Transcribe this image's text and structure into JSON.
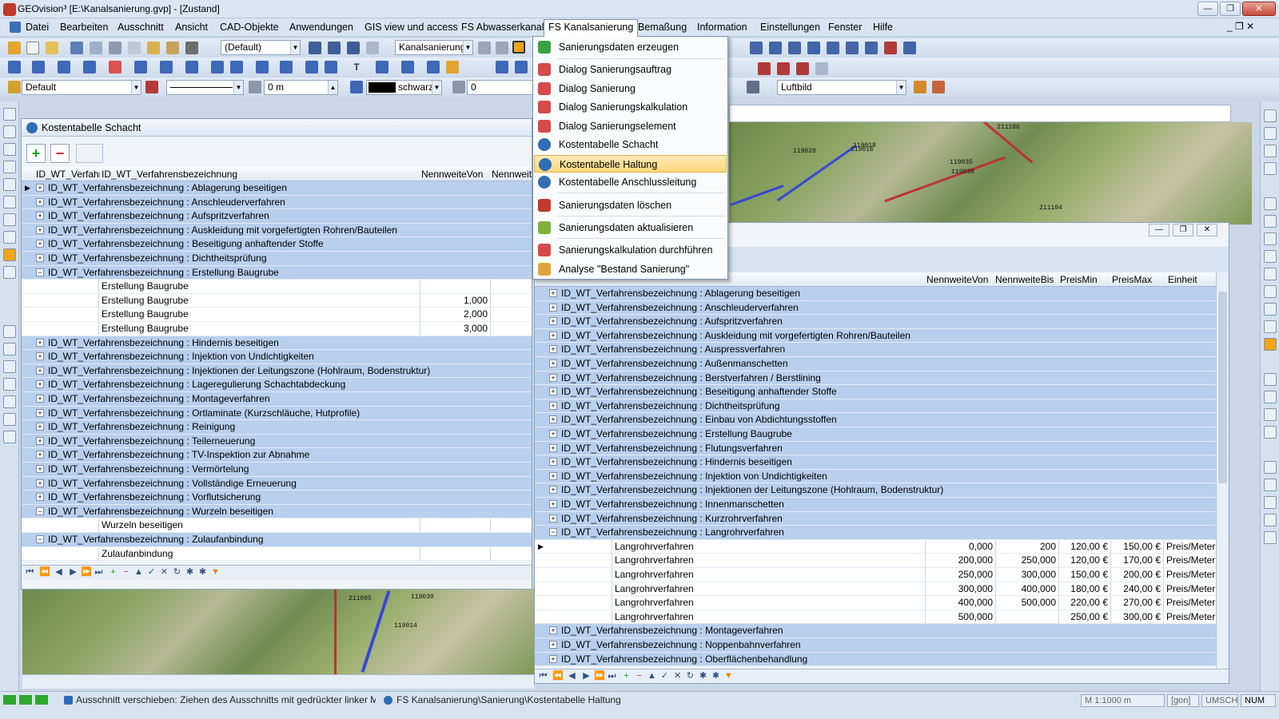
{
  "window": {
    "title": "GEOvision³  [E:\\Kanalsanierung.gvp] - [Zustand]",
    "minimize": "—",
    "restore": "❐",
    "close": "✕"
  },
  "menubar": {
    "items": [
      "Datei",
      "Bearbeiten",
      "Ausschnitt",
      "Ansicht",
      "CAD-Objekte",
      "Anwendungen",
      "GIS view und access",
      "FS Abwasserkanal",
      "FS Kanalsanierung",
      "Bemaßung",
      "Information",
      "Einstellungen",
      "Fenster",
      "Hilfe"
    ],
    "active": "FS Kanalsanierung",
    "mdi_controls": "_  ❐  ✕"
  },
  "toolbar1": {
    "style_combo": "(Default)",
    "layer_combo": "Kanalsanierung"
  },
  "toolbar3": {
    "layer_combo": "Default",
    "distance_value": "0 m",
    "color_name": "schwarz",
    "angle_value": "0",
    "background_combo": "Luftbild"
  },
  "dropdown": {
    "items": [
      "Sanierungsdaten erzeugen",
      "Dialog Sanierungsauftrag",
      "Dialog Sanierung",
      "Dialog Sanierungskalkulation",
      "Dialog Sanierungselement",
      "Kostentabelle Schacht",
      "Kostentabelle Haltung",
      "Kostentabelle Anschlussleitung",
      "Sanierungsdaten löschen",
      "Sanierungsdaten aktualisieren",
      "Sanierungskalkulation durchführen",
      "Analyse \"Bestand Sanierung\""
    ],
    "highlighted": "Kostentabelle Haltung"
  },
  "left_panel": {
    "title": "Kostentabelle Schacht",
    "columns": [
      "ID_WT_Verfahre",
      "ID_WT_Verfahrensbezeichnung",
      "NennweiteVon",
      "Nennweite"
    ],
    "rows": [
      {
        "type": "group",
        "text": "ID_WT_Verfahrensbezeichnung : Ablagerung beseitigen",
        "expanded": false,
        "current": true
      },
      {
        "type": "group",
        "text": "ID_WT_Verfahrensbezeichnung : Anschleuderverfahren",
        "expanded": false
      },
      {
        "type": "group",
        "text": "ID_WT_Verfahrensbezeichnung : Aufspritzverfahren",
        "expanded": false
      },
      {
        "type": "group",
        "text": "ID_WT_Verfahrensbezeichnung : Auskleidung mit vorgefertigten Rohren/Bauteilen",
        "expanded": false
      },
      {
        "type": "group",
        "text": "ID_WT_Verfahrensbezeichnung : Beseitigung anhaftender Stoffe",
        "expanded": false
      },
      {
        "type": "group",
        "text": "ID_WT_Verfahrensbezeichnung : Dichtheitsprüfung",
        "expanded": false
      },
      {
        "type": "group",
        "text": "ID_WT_Verfahrensbezeichnung : Erstellung Baugrube",
        "expanded": true
      },
      {
        "type": "detail",
        "name": "Erstellung Baugrube",
        "von": ""
      },
      {
        "type": "detail",
        "name": "Erstellung Baugrube",
        "von": "1,000"
      },
      {
        "type": "detail",
        "name": "Erstellung Baugrube",
        "von": "2,000"
      },
      {
        "type": "detail",
        "name": "Erstellung Baugrube",
        "von": "3,000"
      },
      {
        "type": "group",
        "text": "ID_WT_Verfahrensbezeichnung : Hindernis beseitigen",
        "expanded": false
      },
      {
        "type": "group",
        "text": "ID_WT_Verfahrensbezeichnung : Injektion von Undichtigkeiten",
        "expanded": false
      },
      {
        "type": "group",
        "text": "ID_WT_Verfahrensbezeichnung : Injektionen der Leitungszone (Hohlraum, Bodenstruktur)",
        "expanded": false
      },
      {
        "type": "group",
        "text": "ID_WT_Verfahrensbezeichnung : Lageregulierung Schachtabdeckung",
        "expanded": false
      },
      {
        "type": "group",
        "text": "ID_WT_Verfahrensbezeichnung : Montageverfahren",
        "expanded": false
      },
      {
        "type": "group",
        "text": "ID_WT_Verfahrensbezeichnung : Ortlaminate (Kurzschläuche, Hutprofile)",
        "expanded": false
      },
      {
        "type": "group",
        "text": "ID_WT_Verfahrensbezeichnung : Reinigung",
        "expanded": false
      },
      {
        "type": "group",
        "text": "ID_WT_Verfahrensbezeichnung : Teilerneuerung",
        "expanded": false
      },
      {
        "type": "group",
        "text": "ID_WT_Verfahrensbezeichnung : TV-Inspektion zur Abnahme",
        "expanded": false
      },
      {
        "type": "group",
        "text": "ID_WT_Verfahrensbezeichnung : Vermörtelung",
        "expanded": false
      },
      {
        "type": "group",
        "text": "ID_WT_Verfahrensbezeichnung : Vollständige Erneuerung",
        "expanded": false
      },
      {
        "type": "group",
        "text": "ID_WT_Verfahrensbezeichnung : Vorflutsicherung",
        "expanded": false
      },
      {
        "type": "group",
        "text": "ID_WT_Verfahrensbezeichnung : Wurzeln beseitigen",
        "expanded": true
      },
      {
        "type": "detail",
        "name": "Wurzeln beseitigen",
        "von": ""
      },
      {
        "type": "group",
        "text": "ID_WT_Verfahrensbezeichnung : Zulaufanbindung",
        "expanded": true
      },
      {
        "type": "detail",
        "name": "Zulaufanbindung",
        "von": ""
      }
    ]
  },
  "right_panel": {
    "columns": [
      "NennweiteVon",
      "NennweiteBis",
      "PreisMin",
      "PreisMax",
      "Einheit"
    ],
    "rows": [
      {
        "type": "group",
        "text": "ID_WT_Verfahrensbezeichnung : Ablagerung beseitigen",
        "expanded": false
      },
      {
        "type": "group",
        "text": "ID_WT_Verfahrensbezeichnung : Anschleuderverfahren",
        "expanded": false
      },
      {
        "type": "group",
        "text": "ID_WT_Verfahrensbezeichnung : Aufspritzverfahren",
        "expanded": false
      },
      {
        "type": "group",
        "text": "ID_WT_Verfahrensbezeichnung : Auskleidung mit vorgefertigten Rohren/Bauteilen",
        "expanded": false
      },
      {
        "type": "group",
        "text": "ID_WT_Verfahrensbezeichnung : Auspressverfahren",
        "expanded": false
      },
      {
        "type": "group",
        "text": "ID_WT_Verfahrensbezeichnung : Außenmanschetten",
        "expanded": false
      },
      {
        "type": "group",
        "text": "ID_WT_Verfahrensbezeichnung : Berstverfahren / Berstlining",
        "expanded": false
      },
      {
        "type": "group",
        "text": "ID_WT_Verfahrensbezeichnung : Beseitigung anhaftender Stoffe",
        "expanded": false
      },
      {
        "type": "group",
        "text": "ID_WT_Verfahrensbezeichnung : Dichtheitsprüfung",
        "expanded": false
      },
      {
        "type": "group",
        "text": "ID_WT_Verfahrensbezeichnung : Einbau von Abdichtungsstoffen",
        "expanded": false
      },
      {
        "type": "group",
        "text": "ID_WT_Verfahrensbezeichnung : Erstellung Baugrube",
        "expanded": false
      },
      {
        "type": "group",
        "text": "ID_WT_Verfahrensbezeichnung : Flutungsverfahren",
        "expanded": false
      },
      {
        "type": "group",
        "text": "ID_WT_Verfahrensbezeichnung : Hindernis beseitigen",
        "expanded": false
      },
      {
        "type": "group",
        "text": "ID_WT_Verfahrensbezeichnung : Injektion von Undichtigkeiten",
        "expanded": false
      },
      {
        "type": "group",
        "text": "ID_WT_Verfahrensbezeichnung : Injektionen der Leitungszone (Hohlraum, Bodenstruktur)",
        "expanded": false
      },
      {
        "type": "group",
        "text": "ID_WT_Verfahrensbezeichnung : Innenmanschetten",
        "expanded": false
      },
      {
        "type": "group",
        "text": "ID_WT_Verfahrensbezeichnung : Kurzrohrverfahren",
        "expanded": false
      },
      {
        "type": "group",
        "text": "ID_WT_Verfahrensbezeichnung : Langrohrverfahren",
        "expanded": true
      },
      {
        "type": "detail",
        "name": "Langrohrverfahren",
        "von": "0,000",
        "bis": "200",
        "min": "120,00 €",
        "max": "150,00 €",
        "unit": "Preis/Meter",
        "current": true
      },
      {
        "type": "detail",
        "name": "Langrohrverfahren",
        "von": "200,000",
        "bis": "250,000",
        "min": "120,00 €",
        "max": "170,00 €",
        "unit": "Preis/Meter"
      },
      {
        "type": "detail",
        "name": "Langrohrverfahren",
        "von": "250,000",
        "bis": "300,000",
        "min": "150,00 €",
        "max": "200,00 €",
        "unit": "Preis/Meter"
      },
      {
        "type": "detail",
        "name": "Langrohrverfahren",
        "von": "300,000",
        "bis": "400,000",
        "min": "180,00 €",
        "max": "240,00 €",
        "unit": "Preis/Meter"
      },
      {
        "type": "detail",
        "name": "Langrohrverfahren",
        "von": "400,000",
        "bis": "500,000",
        "min": "220,00 €",
        "max": "270,00 €",
        "unit": "Preis/Meter"
      },
      {
        "type": "detail",
        "name": "Langrohrverfahren",
        "von": "500,000",
        "bis": "",
        "min": "250,00 €",
        "max": "300,00 €",
        "unit": "Preis/Meter"
      },
      {
        "type": "group",
        "text": "ID_WT_Verfahrensbezeichnung : Montageverfahren",
        "expanded": false
      },
      {
        "type": "group",
        "text": "ID_WT_Verfahrensbezeichnung : Noppenbahnverfahren",
        "expanded": false
      },
      {
        "type": "group",
        "text": "ID_WT_Verfahrensbezeichnung : Oberflächenbehandlung",
        "expanded": false
      }
    ]
  },
  "map_labels": {
    "top": [
      "119020",
      "119016",
      "119018",
      "211106",
      "211104",
      "119030",
      "119035"
    ],
    "bottom": [
      "211085",
      "119030",
      "119014"
    ]
  },
  "statusbar": {
    "message": "Ausschnitt verschieben: Ziehen des Ausschnitts mit gedrückter linker Maustaste",
    "path": "FS Kanalsanierung\\Sanierung\\Kostentabelle Haltung",
    "scale": "M 1:1000 m",
    "unit": "[gon]",
    "umsch": "UMSCH",
    "num": "NUM"
  },
  "colors": {
    "group_row": "#b8cfee",
    "highlight": "#fbd87b",
    "pipe": "#3548d8"
  }
}
